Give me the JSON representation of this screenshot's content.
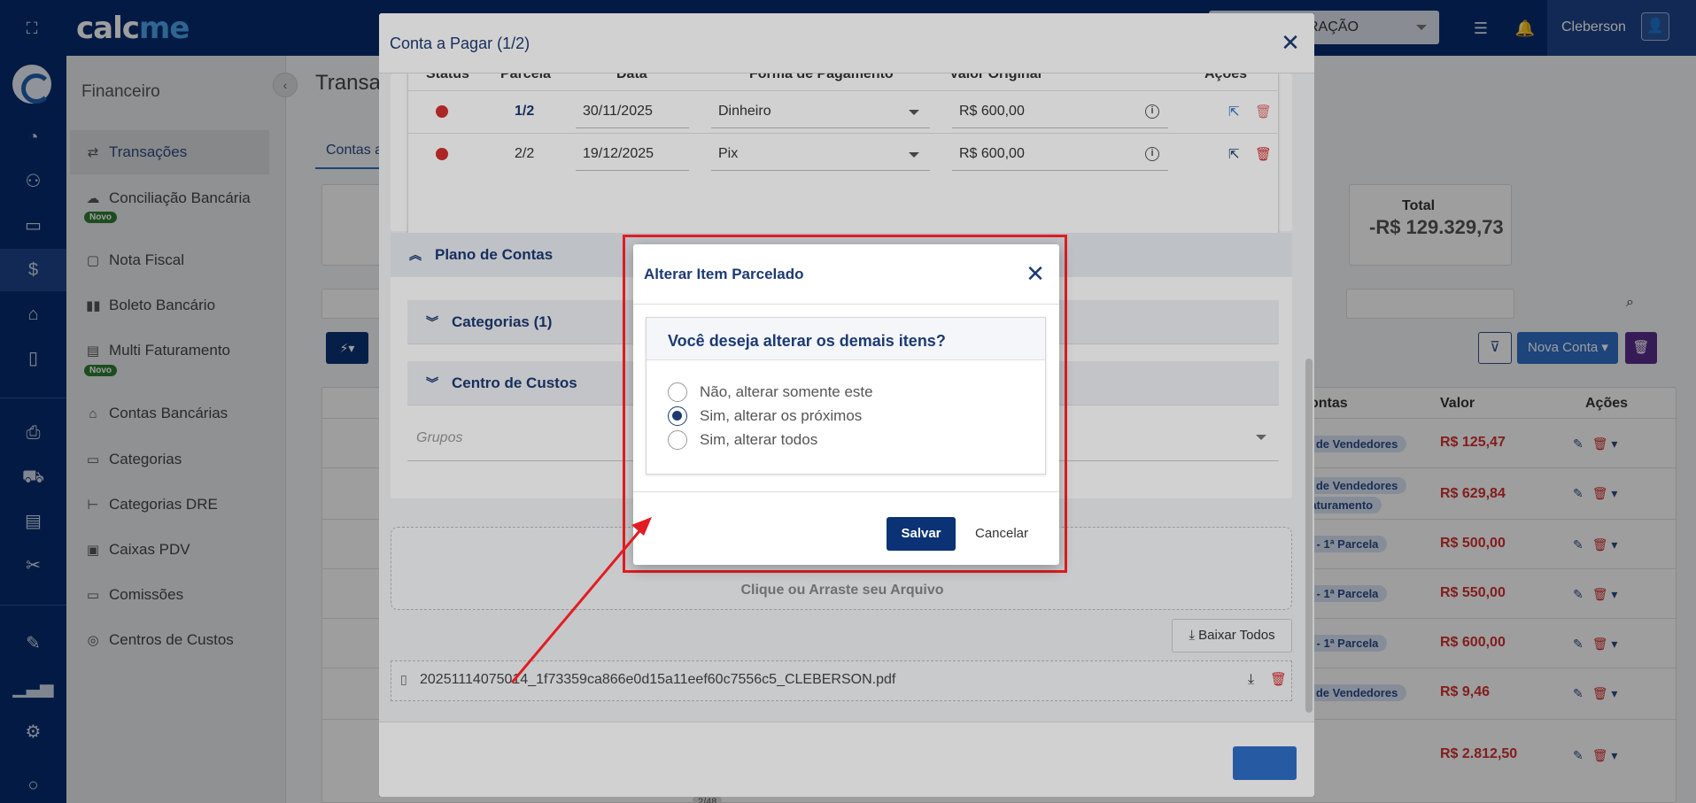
{
  "topbar": {
    "logo_main": "calc",
    "logo_accent": "me",
    "company_text": "RAÇÃO",
    "user_name": "Cleberson"
  },
  "sidebar": {
    "title": "Financeiro",
    "new_badge": "Novo",
    "items": [
      {
        "label": "Transações",
        "icon": "swap-icon"
      },
      {
        "label": "Conciliação Bancária",
        "icon": "cloud-sync-icon"
      },
      {
        "label": "Nota Fiscal",
        "icon": "document-icon"
      },
      {
        "label": "Boleto Bancário",
        "icon": "barcode-icon"
      },
      {
        "label": "Multi Faturamento",
        "icon": "invoice-icon"
      },
      {
        "label": "Contas Bancárias",
        "icon": "bank-icon"
      },
      {
        "label": "Categorias",
        "icon": "folder-icon"
      },
      {
        "label": "Categorias DRE",
        "icon": "tree-icon"
      },
      {
        "label": "Caixas PDV",
        "icon": "register-icon"
      },
      {
        "label": "Comissões",
        "icon": "commission-icon"
      },
      {
        "label": "Centros de Custos",
        "icon": "cost-center-icon"
      }
    ]
  },
  "background_page": {
    "title": "Transa",
    "tab": "Contas a",
    "total_label": "Total",
    "total_value": "-R$ 129.329,73",
    "nova_conta": "Nova Conta",
    "col_contas": "ontas",
    "col_valor": "Valor",
    "col_acoes": "Ações",
    "pager": "2/48",
    "rows": [
      {
        "tag": "s de Vendedores",
        "tag2": "",
        "value": "R$ 125,47"
      },
      {
        "tag": "s de Vendedores",
        "tag2": "faturamento",
        "value": "R$ 629,84"
      },
      {
        "tag": "o - 1ª Parcela",
        "tag2": "",
        "value": "R$ 500,00"
      },
      {
        "tag": "o - 1ª Parcela",
        "tag2": "",
        "value": "R$ 550,00"
      },
      {
        "tag": "o - 1ª Parcela",
        "tag2": "",
        "value": "R$ 600,00"
      },
      {
        "tag": "s de Vendedores",
        "tag2": "",
        "value": "R$ 9,46"
      },
      {
        "tag": "",
        "tag2": "",
        "value": "R$ 2.812,50"
      }
    ]
  },
  "modal": {
    "title": "Conta a Pagar (1/2)",
    "columns": {
      "status": "Status",
      "parcela": "Parcela",
      "data": "Data",
      "forma": "Forma de Pagamento",
      "valor": "Valor Original",
      "acoes": "Ações"
    },
    "installments": [
      {
        "parcela": "1/2",
        "data": "30/11/2025",
        "forma": "Dinheiro",
        "valor": "R$ 600,00"
      },
      {
        "parcela": "2/2",
        "data": "19/12/2025",
        "forma": "Pix",
        "valor": "R$ 600,00"
      }
    ],
    "plano_de_contas": "Plano de Contas",
    "categorias": "Categorias (1)",
    "centro_de_custos": "Centro de Custos",
    "grupos_placeholder": "Grupos",
    "dropzone_text": "Clique ou Arraste seu Arquivo",
    "baixar_todos": "Baixar Todos",
    "file_name": "20251114075014_1f73359ca866e0d15a11eef60c7556c5_CLEBERSON.pdf"
  },
  "dialog": {
    "title": "Alterar Item Parcelado",
    "question": "Você deseja alterar os demais itens?",
    "options": [
      {
        "label": "Não, alterar somente este",
        "checked": false
      },
      {
        "label": "Sim, alterar os próximos",
        "checked": true
      },
      {
        "label": "Sim, alterar todos",
        "checked": false
      }
    ],
    "save_label": "Salvar",
    "cancel_label": "Cancelar"
  },
  "colors": {
    "navy": "#062c6e",
    "accent_blue": "#2f6fc7",
    "danger_red": "#d32f2f",
    "highlight_red": "#e11d22"
  }
}
